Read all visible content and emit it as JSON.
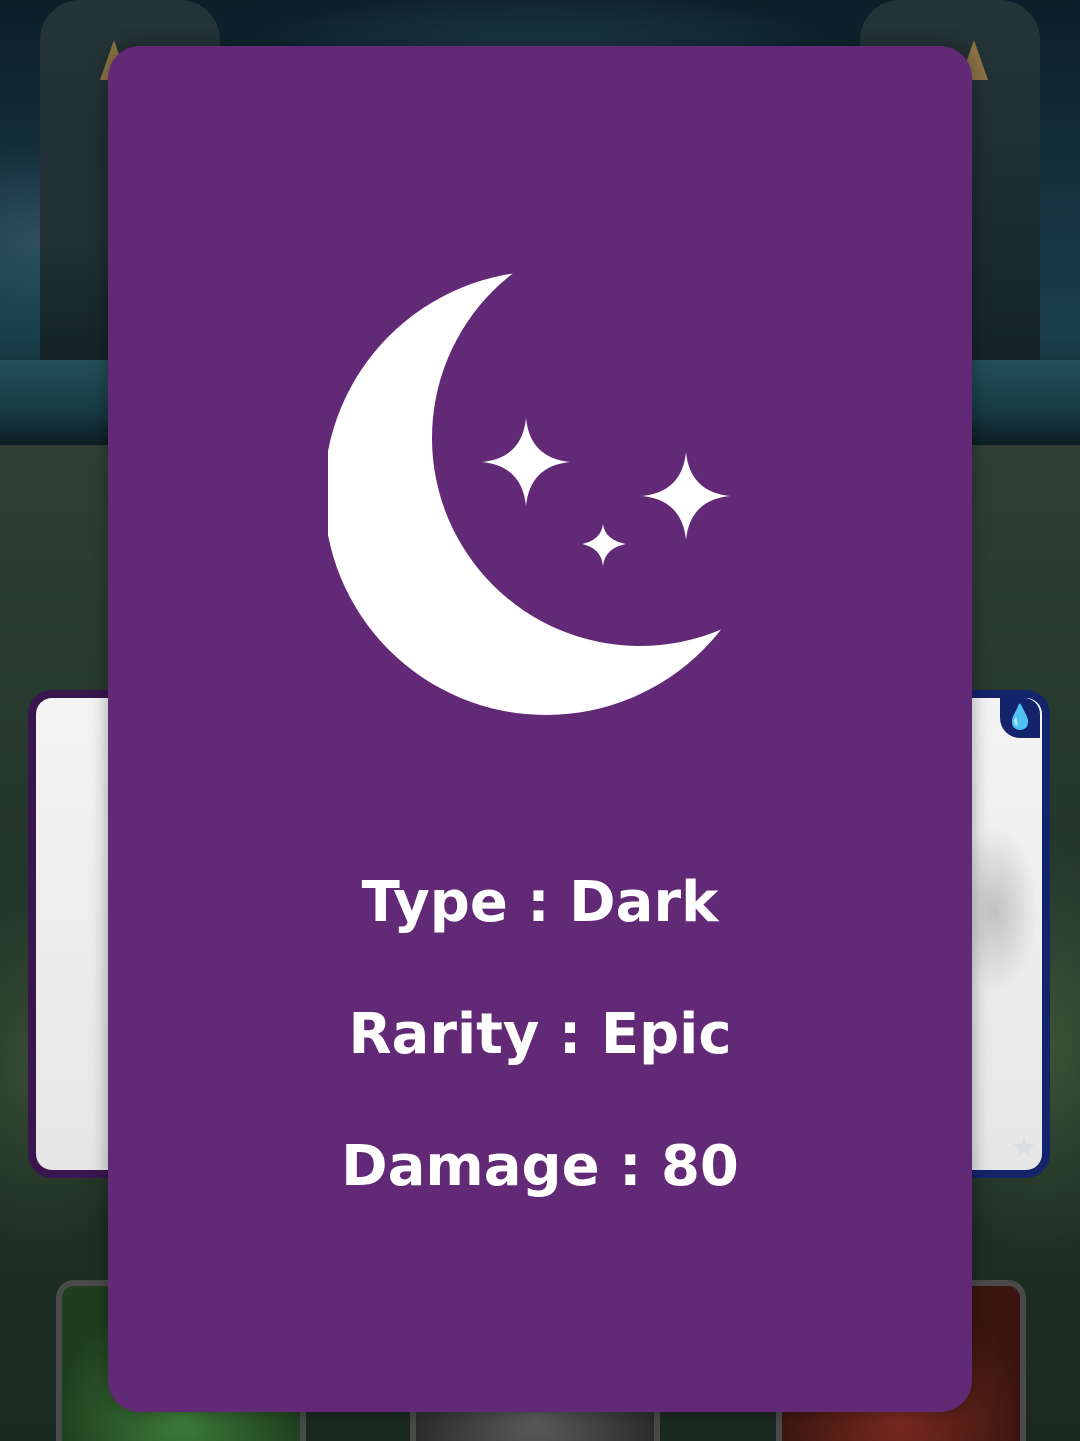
{
  "card": {
    "element_icon": "crescent-moon-stars-icon",
    "background_color": "#622a76",
    "stats": {
      "type": "Type : Dark",
      "rarity": "Rarity : Epic",
      "damage": "Damage : 80"
    }
  },
  "background": {
    "side_card_left_color": "#3a1650",
    "side_card_right_color": "#14246a",
    "side_card_right_icons": [
      "water-drops-icon",
      "star-icon"
    ]
  }
}
